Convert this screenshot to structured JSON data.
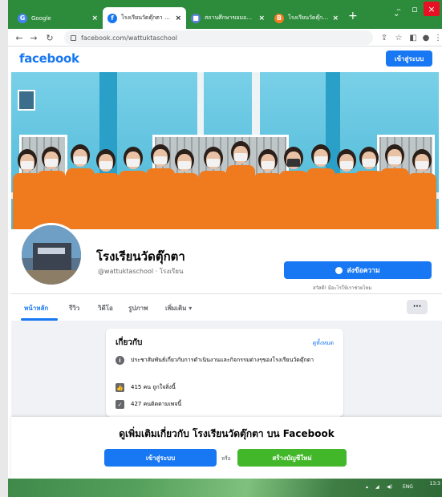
{
  "browser": {
    "tabs": [
      {
        "label": "Google",
        "favicon": "G",
        "favicon_color": "#4285f4",
        "active": false
      },
      {
        "label": "โรงเรียนวัดตุ๊กตา - หน้า",
        "favicon": "f",
        "favicon_color": "#1877f2",
        "active": true
      },
      {
        "label": "สถานศึกษาขอมอบกับ วิ",
        "favicon": "■",
        "favicon_color": "#5b7fd6",
        "active": false
      },
      {
        "label": "โรงเรียนวัดตุ๊กตา",
        "favicon": "B",
        "favicon_color": "#f47b20",
        "active": false
      }
    ],
    "new_tab": "+",
    "url": "facebook.com/wattuktaschool"
  },
  "fb": {
    "logo": "facebook",
    "login_top": "เข้าสู่ระบบ",
    "page_name": "โรงเรียนวัดตุ๊กตา",
    "handle": "@wattuktaschool · โรงเรียน",
    "message_button": "ส่งข้อความ",
    "reply_hint": "สวัสดี! มีอะไรให้เราช่วยไหม",
    "nav_tabs": [
      "หน้าหลัก",
      "รีวิว",
      "วิดีโอ",
      "รูปภาพ",
      "เพิ่มเติม ▾"
    ],
    "more_dots": "···",
    "about": {
      "title": "เกี่ยวกับ",
      "see_all": "ดูทั้งหมด",
      "description": "ประชาสัมพันธ์เกี่ยวกับการดำเนินงานและกิจกรรมต่างๆของโรงเรียนวัดตุ๊กตา",
      "likes": "415 คน ถูกใจสิ่งนี้",
      "followers": "427 คนติดตามเพจนี้"
    },
    "banner": {
      "title": "ดูเพิ่มเติมเกี่ยวกับ โรงเรียนวัดตุ๊กตา บน Facebook",
      "login": "เข้าสู่ระบบ",
      "or": "หรือ",
      "create": "สร้างบัญชีใหม่"
    }
  },
  "taskbar": {
    "lang": "ENG",
    "time": "13:3"
  },
  "colors": {
    "fb_blue": "#1877f2",
    "fb_green": "#42b72a",
    "uniform_orange": "#f07a1e"
  }
}
